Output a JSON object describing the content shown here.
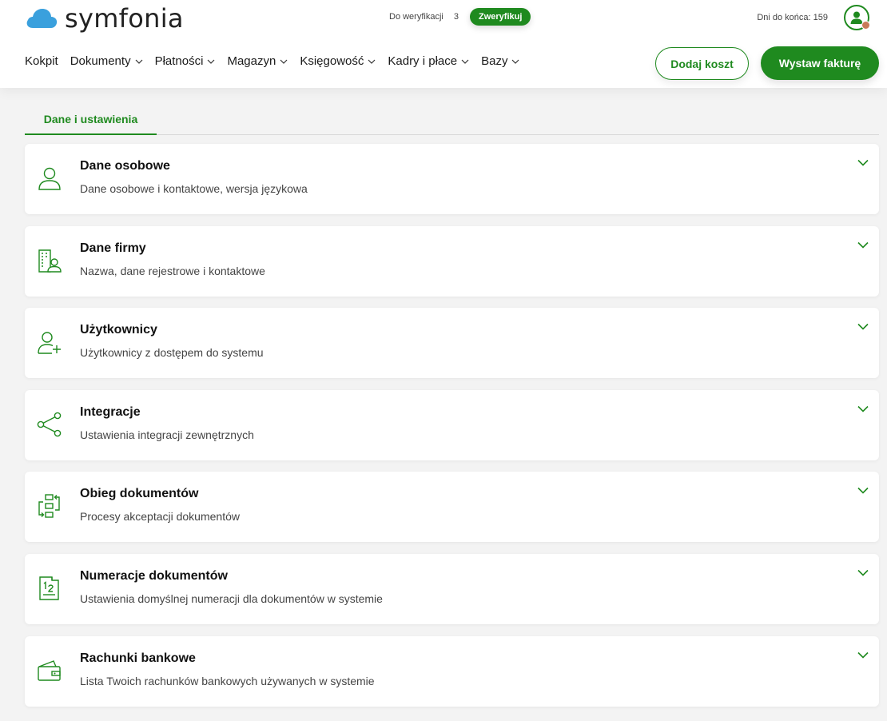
{
  "brand": {
    "name": "symfonia",
    "color": "#1f8a1f",
    "cloud_color": "#3aa0dd"
  },
  "header": {
    "verify_label": "Do weryfikacji",
    "verify_count": "3",
    "verify_button": "Zweryfikuj",
    "days_left": "Dni do końca: 159"
  },
  "nav": {
    "items": [
      {
        "label": "Kokpit",
        "dropdown": false
      },
      {
        "label": "Dokumenty",
        "dropdown": true
      },
      {
        "label": "Płatności",
        "dropdown": true
      },
      {
        "label": "Magazyn",
        "dropdown": true
      },
      {
        "label": "Księgowość",
        "dropdown": true
      },
      {
        "label": "Kadry i płace",
        "dropdown": true
      },
      {
        "label": "Bazy",
        "dropdown": true
      }
    ]
  },
  "actions": {
    "add_cost": "Dodaj koszt",
    "issue_invoice": "Wystaw fakturę"
  },
  "tabs": {
    "active": "Dane i ustawienia"
  },
  "sections": [
    {
      "title": "Dane osobowe",
      "description": "Dane osobowe i kontaktowe, wersja językowa",
      "icon": "person-icon"
    },
    {
      "title": "Dane firmy",
      "description": "Nazwa, dane rejestrowe i kontaktowe",
      "icon": "company-icon"
    },
    {
      "title": "Użytkownicy",
      "description": "Użytkownicy z dostępem do systemu",
      "icon": "add-user-icon"
    },
    {
      "title": "Integracje",
      "description": "Ustawienia integracji zewnętrznych",
      "icon": "share-icon"
    },
    {
      "title": "Obieg dokumentów",
      "description": "Procesy akceptacji dokumentów",
      "icon": "workflow-icon"
    },
    {
      "title": "Numeracje dokumentów",
      "description": "Ustawienia domyślnej numeracji dla dokumentów w systemie",
      "icon": "numbering-icon"
    },
    {
      "title": "Rachunki bankowe",
      "description": "Lista Twoich rachunków bankowych używanych w systemie",
      "icon": "wallet-icon"
    }
  ]
}
